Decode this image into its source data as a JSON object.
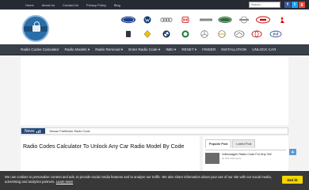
{
  "topbar": {
    "links": [
      "Home",
      "About Us",
      "Contact Us",
      "Privacy Policy",
      "Blog"
    ],
    "search_placeholder": "Search..."
  },
  "social_icons": [
    {
      "name": "facebook-icon",
      "glyph": "f",
      "color": "#3b5998"
    },
    {
      "name": "twitter-icon",
      "glyph": "t",
      "color": "#1da1f2"
    },
    {
      "name": "google-plus-icon",
      "glyph": "g",
      "color": "#dd4b39"
    }
  ],
  "car_brand_logos": [
    "ford-logo",
    "volkswagen-logo",
    "audi-logo",
    "honda-logo",
    "land-rover-logo",
    "kia-logo",
    "peugeot-logo",
    "renault-logo",
    "bmw-logo",
    "skoda-logo",
    "mercedes-logo",
    "opel-logo",
    "mazda-logo",
    "toyota-logo",
    "hyundai-logo"
  ],
  "nav": {
    "items": [
      "Radio Codes Calculator",
      "Radio Models ▾",
      "Radio Removal ▾",
      "Enter Radio Code ▾",
      "IMEI ▾",
      "RESET ▾",
      "FINDER",
      "INSTALLATION",
      "UNLOCK CAR"
    ]
  },
  "news": {
    "label": "News",
    "headline": "Nissan Pathfinder Radio Code"
  },
  "main": {
    "title": "Radio Codes Calculator To Unlock Any Car Radio Model By Code"
  },
  "sidebar": {
    "tabs": [
      "Popular Post",
      "Latest Post"
    ],
    "post_title": "Volkswagen Radio Code For Any VW",
    "post_meta": "by 333 Comments"
  },
  "back_to_top": "▲",
  "cookie": {
    "message": "We use cookies to personalise content and ads, to provide social media features and to analyse our traffic. We also share information about your use of our site with our social media, advertising and analytics partners.",
    "learn_more": "Learn more",
    "button": "Got it!"
  }
}
